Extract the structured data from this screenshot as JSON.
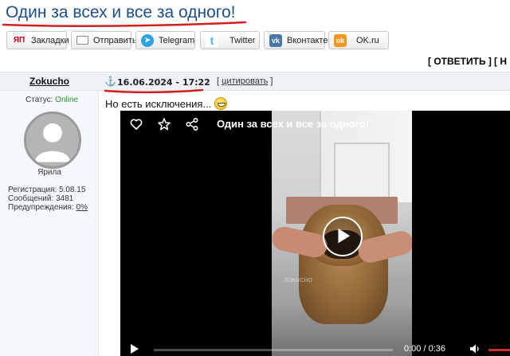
{
  "topic": {
    "title": "Один за всех и все за одного!"
  },
  "share": {
    "buttons": [
      {
        "label": "Закладки",
        "icon": "yandex-bookmarks-icon",
        "icon_text": "ЯП"
      },
      {
        "label": "Отправить",
        "icon": "mail-icon",
        "icon_text": ""
      },
      {
        "label": "Telegram",
        "icon": "telegram-icon",
        "icon_text": "➤"
      },
      {
        "label": "Twitter",
        "icon": "twitter-icon",
        "icon_text": "t"
      },
      {
        "label": "Вконтакте",
        "icon": "vk-icon",
        "icon_text": "vk"
      },
      {
        "label": "OK.ru",
        "icon": "ok-icon",
        "icon_text": "ok"
      }
    ]
  },
  "reply_bar": {
    "reply_label": "[ ОТВЕТИТЬ ]",
    "more_label": "[ Н"
  },
  "post": {
    "author": "Zokucho",
    "date": "16.06.2024 - 17:22",
    "quote_open": "[ ",
    "quote_label": "цитировать",
    "quote_close": " ]",
    "text": "Но есть исключения..."
  },
  "user": {
    "status_label": "Статус: ",
    "status_value": "Online",
    "rank": "Ярила",
    "registration": "Регистрация: 5.08.15",
    "messages": "Сообщений: 3481",
    "warnings_label": "Предупреждения: ",
    "warnings_value": "0%"
  },
  "video": {
    "title": "Один за всех и все за одного!",
    "time": "0:00  /  0:36",
    "progress": 0.0,
    "watermark": "ZOKUCHO",
    "colors": {
      "volume": "#d12a2a",
      "title_underline": "#d11f1f"
    }
  }
}
